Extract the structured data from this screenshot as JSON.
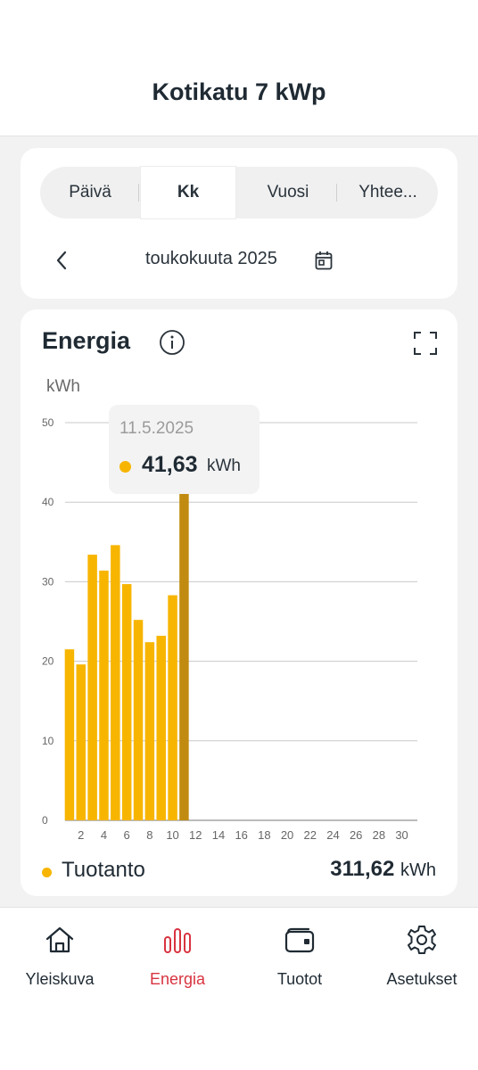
{
  "header": {
    "title": "Kotikatu 7 kWp"
  },
  "period_tabs": [
    {
      "label": "Päivä",
      "active": false
    },
    {
      "label": "Kk",
      "active": true
    },
    {
      "label": "Vuosi",
      "active": false
    },
    {
      "label": "Yhtee...",
      "active": false
    }
  ],
  "period": {
    "label": "toukokuuta 2025",
    "back_icon": "chevron-left-icon",
    "calendar_icon": "calendar-icon"
  },
  "energy_card": {
    "title": "Energia",
    "info_icon": "info-icon",
    "expand_icon": "expand-icon",
    "unit": "kWh"
  },
  "tooltip": {
    "date": "11.5.2025",
    "value": "41,63",
    "unit": "kWh"
  },
  "legend": {
    "label": "Tuotanto",
    "total": "311,62",
    "unit": "kWh"
  },
  "chart_data": {
    "type": "bar",
    "ylabel": "kWh",
    "ylim": [
      0,
      50
    ],
    "yticks": [
      0,
      10,
      20,
      30,
      40,
      50
    ],
    "xticks": [
      2,
      4,
      6,
      8,
      10,
      12,
      14,
      16,
      18,
      20,
      22,
      24,
      26,
      28,
      30
    ],
    "x": [
      1,
      2,
      3,
      4,
      5,
      6,
      7,
      8,
      9,
      10,
      11
    ],
    "values": [
      21.5,
      19.6,
      33.4,
      31.4,
      34.6,
      29.7,
      25.2,
      22.4,
      23.2,
      28.3,
      41.63
    ],
    "highlighted_index": 10,
    "colors": {
      "bar": "#f7b500",
      "highlight": "#c08b10",
      "grid": "#c8c8c8",
      "axis": "#777777"
    },
    "grid": true
  },
  "nav": [
    {
      "label": "Yleiskuva",
      "icon": "home-icon",
      "active": false
    },
    {
      "label": "Energia",
      "icon": "bar-chart-icon",
      "active": true
    },
    {
      "label": "Tuotot",
      "icon": "wallet-icon",
      "active": false
    },
    {
      "label": "Asetukset",
      "icon": "gear-icon",
      "active": false
    }
  ],
  "colors": {
    "accent": "#d8333f",
    "production": "#f7b500"
  }
}
